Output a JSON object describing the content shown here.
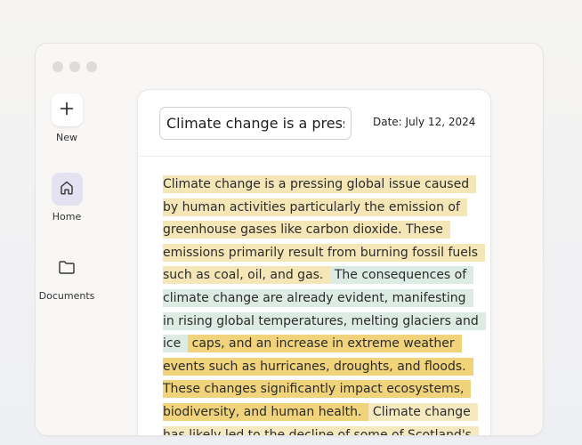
{
  "sidebar": {
    "items": [
      {
        "label": "New",
        "icon": "plus-icon"
      },
      {
        "label": "Home",
        "icon": "home-icon"
      },
      {
        "label": "Documents",
        "icon": "folder-icon"
      }
    ]
  },
  "document": {
    "title_value": "Climate change is a pressing global issue",
    "date_text": "Date: July 12, 2024",
    "segments": [
      {
        "text": "Climate change is a pressing global issue caused by human activities particularly the emission of greenhouse gases like carbon dioxide. These emissions primarily result from burning fossil fuels such as coal, oil, and gas.",
        "color": "#f5e6b8"
      },
      {
        "text": " The consequences of climate change are already evident, manifesting in rising global temperatures, melting glaciers and ice",
        "color": "#dcebe3"
      },
      {
        "text": " caps, and an increase in extreme weather events such as hurricanes, droughts, and floods. These changes significantly impact ecosystems, biodiversity, and human health.",
        "color": "#f0d37a"
      },
      {
        "text": " Climate change has likely led to the decline of some of Scotland's",
        "color": "#f6e9bf"
      }
    ]
  }
}
